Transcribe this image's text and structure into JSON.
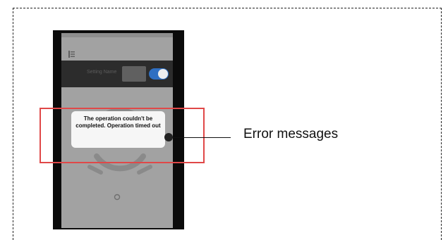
{
  "phone": {
    "toggle_row": {
      "label": "Setting Name",
      "toggle_on": true,
      "accent_color": "#2f6fc2"
    },
    "icons": {
      "menu": "menu-icon",
      "gauge": "gauge-icon",
      "small": "small-icon"
    }
  },
  "toast": {
    "message": "The operation couldn't be completed. Operation timed out"
  },
  "annotation": {
    "label": "Error messages",
    "highlight_color": "#e04848"
  }
}
